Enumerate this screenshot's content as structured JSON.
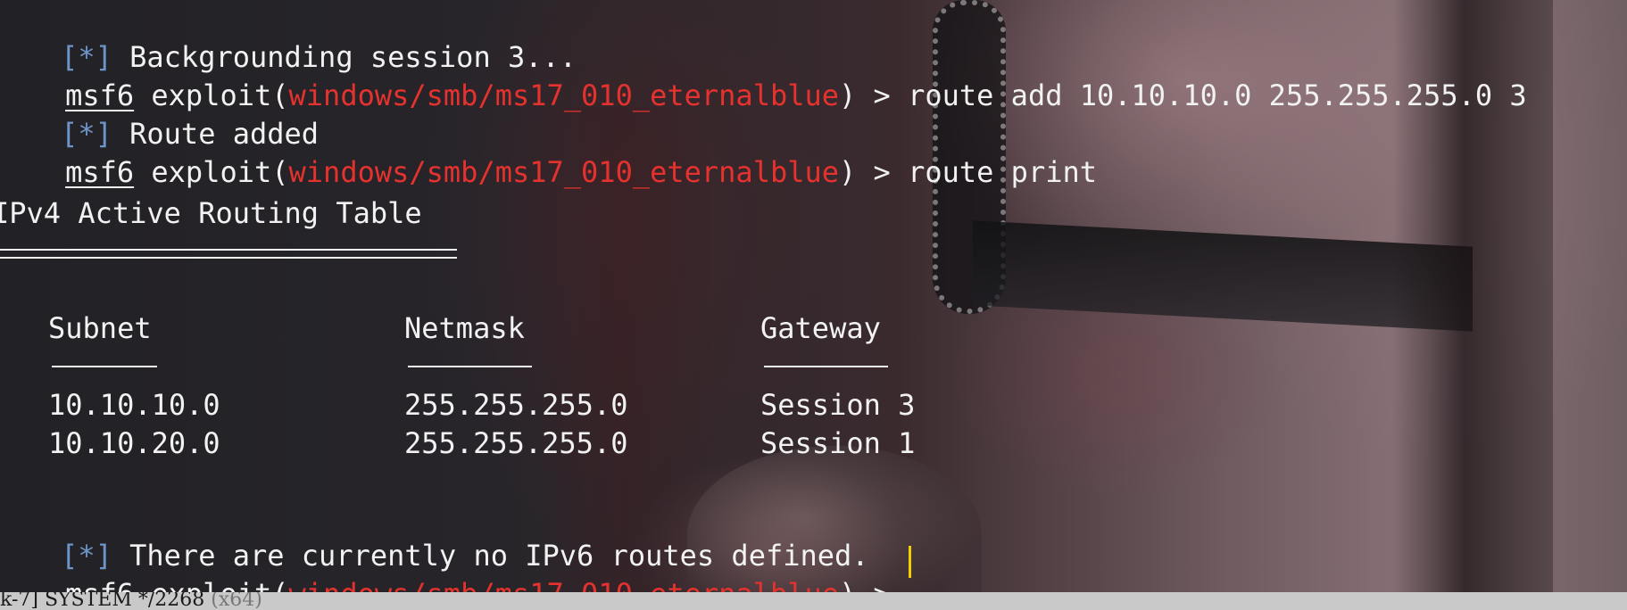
{
  "terminal": {
    "prompt_prefix": "msf6",
    "exploit_open": " exploit(",
    "module": "windows/smb/ms17_010_eternalblue",
    "exploit_close": ") > ",
    "info_bracket_open": "[",
    "info_star": "*",
    "info_bracket_close": "]",
    "lines": {
      "bg_session": " Backgrounding session 3...",
      "cmd_route_add": "route add 10.10.10.0 255.255.255.0 3",
      "route_added": " Route added",
      "cmd_route_print": "route print",
      "no_ipv6": " There are currently no IPv6 routes defined."
    },
    "routing_table": {
      "title": "IPv4 Active Routing Table",
      "headers": [
        "Subnet",
        "Netmask",
        "Gateway"
      ],
      "rows": [
        [
          "10.10.10.0",
          "255.255.255.0",
          "Session 3"
        ],
        [
          "10.10.20.0",
          "255.255.255.0",
          "Session 1"
        ]
      ]
    }
  },
  "statusbar": {
    "text": "k-7] SYSTEM */2268",
    "arch": " (x64)"
  },
  "colors": {
    "module_red": "#e5322e",
    "bracket_blue": "#6f94c8",
    "cursor_yellow": "#f0d000",
    "text": "#f2f2f2"
  }
}
